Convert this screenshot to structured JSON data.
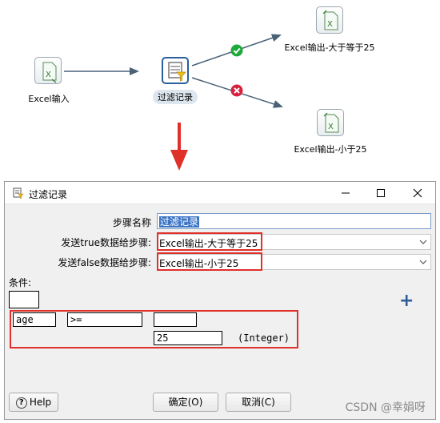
{
  "flow": {
    "nodes": {
      "excel_input": {
        "label": "Excel输入",
        "icon": "excel-file-icon"
      },
      "filter": {
        "label": "过滤记录",
        "icon": "filter-rows-icon"
      },
      "excel_output_ge": {
        "label": "Excel输出-大于等于25",
        "icon": "excel-file-icon"
      },
      "excel_output_lt": {
        "label": "Excel输出-小于25",
        "icon": "excel-file-icon"
      }
    },
    "hops": {
      "true_icon": "check-circle-icon",
      "false_icon": "x-circle-icon"
    },
    "colors": {
      "hop_line": "#4a6278",
      "true": "#1eaa3a",
      "false": "#d8213c",
      "arrow": "#e0302a"
    }
  },
  "dialog": {
    "title": "过滤记录",
    "step_name_label": "步骤名称",
    "step_name_value": "过滤记录",
    "send_true_label": "发送true数据给步骤:",
    "send_true_value": "Excel输出-大于等于25",
    "send_false_label": "发送false数据给步骤:",
    "send_false_value": "Excel输出-小于25",
    "condition_label": "条件:",
    "condition": {
      "field": "age",
      "operator": ">=",
      "value": "25",
      "value_type": "(Integer)"
    },
    "buttons": {
      "help": "Help",
      "ok": "确定(O)",
      "cancel": "取消(C)"
    }
  },
  "watermark": "CSDN @幸娟呀",
  "accent_color": "#3b74c5"
}
